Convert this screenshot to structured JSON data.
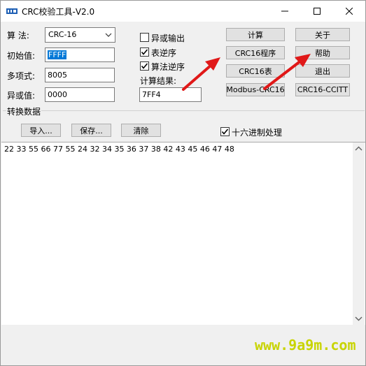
{
  "window": {
    "title": "CRC校验工具-V2.0",
    "titlebar_buttons": [
      "minimize-icon",
      "maximize-icon",
      "close-icon"
    ]
  },
  "form": {
    "algorithm_label": "算  法:",
    "algorithm_value": "CRC-16",
    "initial_label": "初始值:",
    "initial_value": "FFFF",
    "polynomial_label": "多项式:",
    "polynomial_value": "8005",
    "xor_label": "异或值:",
    "xor_value": "0000"
  },
  "options": {
    "xor_output_label": "异或输出",
    "xor_output_checked": false,
    "table_reverse_label": "表逆序",
    "table_reverse_checked": true,
    "algo_reverse_label": "算法逆序",
    "algo_reverse_checked": true,
    "result_label": "计算结果:",
    "result_value": "7FF4"
  },
  "buttons": {
    "calculate": "计算",
    "about": "关于",
    "crc16_program": "CRC16程序",
    "help": "帮助",
    "crc16_table": "CRC16表",
    "exit": "退出",
    "modbus": "Modbus-CRC16",
    "ccitt": "CRC16-CCITT"
  },
  "convert": {
    "section_label": "转换数据",
    "import": "导入...",
    "save": "保存...",
    "clear": "清除",
    "hex_label": "十六进制处理",
    "hex_checked": true,
    "data_text": "22 33 55 66 77 55 24 32 34 35 36 37 38 42 43 45 46 47 48"
  },
  "watermark": "www.9a9m.com",
  "colors": {
    "annotation_arrow": "#e01818",
    "selection": "#0078d7",
    "watermark": "#c8d400"
  }
}
